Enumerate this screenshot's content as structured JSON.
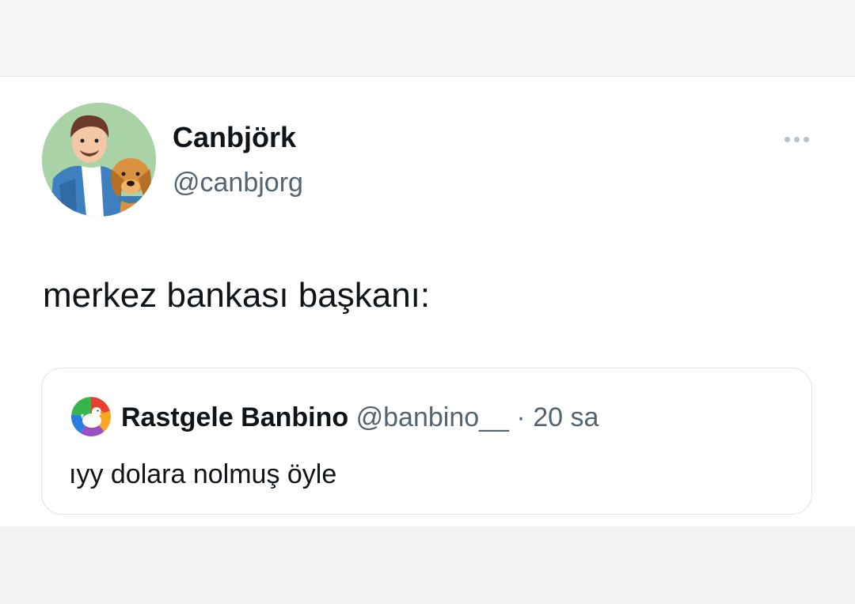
{
  "tweet": {
    "author": {
      "display_name": "Canbjörk",
      "handle": "@canbjorg"
    },
    "text": "merkez bankası başkanı:",
    "more_icon": "more-horizontal-icon"
  },
  "quoted_tweet": {
    "author": {
      "display_name": "Rastgele Banbino",
      "handle": "@banbino__"
    },
    "separator": "·",
    "time": "20 sa",
    "text": "ıyy dolara nolmuş öyle"
  },
  "colors": {
    "text_primary": "#0f1419",
    "text_secondary": "#536471",
    "border": "#dfe4e8",
    "avatar_bg": "#a9d2a6"
  }
}
